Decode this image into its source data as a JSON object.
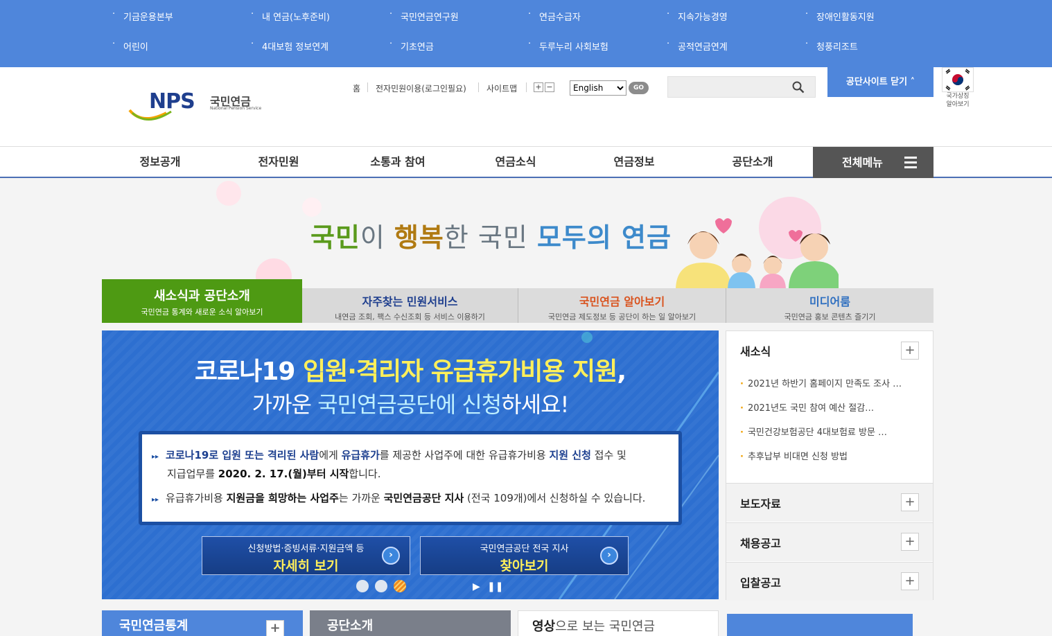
{
  "top_links": [
    [
      "기금운용본부",
      "내 연금(노후준비)",
      "국민연금연구원",
      "연금수급자",
      "지속가능경영",
      "장애인활동지원"
    ],
    [
      "어린이",
      "4대보험 정보연계",
      "기초연금",
      "두루누리 사회보험",
      "공적연금연계",
      "청풍리조트"
    ]
  ],
  "logo": {
    "mark": "NPS",
    "kr": "국민연금",
    "en": "National Pension Service"
  },
  "util": {
    "home": "홈",
    "ecivil": "전자민원이용(로그인필요)",
    "sitemap": "사이트맵",
    "font_plus": "+",
    "font_minus": "−",
    "lang": "English",
    "go": "GO"
  },
  "search": {
    "placeholder": ""
  },
  "close_site": "공단사이트 닫기 ˄",
  "flag_caption": [
    "국가상징",
    "알아보기"
  ],
  "gnb": [
    "정보공개",
    "전자민원",
    "소통과 참여",
    "연금소식",
    "연금정보",
    "공단소개"
  ],
  "all_menu": "전체메뉴",
  "slogan": {
    "s1": "국민",
    "s1b": "이 ",
    "s2": "행복",
    "s3": "한 국민 ",
    "s4": "모두의 연금"
  },
  "tabs": [
    {
      "title": "새소식과 공단소개",
      "desc": "국민연금 통계와 새로운 소식 알아보기",
      "color": "#ffffff"
    },
    {
      "title": "자주찾는 민원서비스",
      "desc": "내연금 조회, 팩스 수신조회 등 서비스 이용하기",
      "color": "#1f3f8e"
    },
    {
      "title": "국민연금 알아보기",
      "desc": "국민연금 제도정보 등 공단이 하는 일 알아보기",
      "color": "#d9531e"
    },
    {
      "title": "미디어룸",
      "desc": "국민연금 홍보 콘텐츠 즐기기",
      "color": "#2f6fc0"
    }
  ],
  "banner": {
    "h1a": "코로나19 ",
    "h1b": "입원·격리자 유급휴가비용 지원",
    "h1c": ",",
    "h2a": "가까운 ",
    "h2b": "국민연금공단에 신청",
    "h2c": "하세요!",
    "p1a": "코로나19로 입원 또는 격리된 사람",
    "p1b": "에게 ",
    "p1c": "유급휴가",
    "p1d": "를 제공한 사업주에 대한 유급휴가비용 ",
    "p1e": "지원 신청",
    "p1f": " 접수 및",
    "p1g": "지급업무를 ",
    "p1h": "2020. 2. 17.(월)부터 시작",
    "p1i": "합니다.",
    "p2a": "유급휴가비용 ",
    "p2b": "지원금을 희망하는 사업주",
    "p2c": "는 가까운 ",
    "p2d": "국민연금공단 지사",
    "p2e": " (전국 109개)에서 신청하실 수 있습니다.",
    "btn1_small": "신청방법·증빙서류·지원금액 등",
    "btn1_big": "자세히 보기",
    "btn2_small": "국민연금공단 전국 지사",
    "btn2_big": "찾아보기"
  },
  "news": {
    "title": "새소식",
    "items": [
      "2021년 하반기 홈페이지 만족도 조사 …",
      "2021년도 국민 참여 예산 절감…",
      "국민건강보험공단 4대보험료 방문 …",
      "추후납부 비대면 신청 방법"
    ],
    "sections": [
      "보도자료",
      "채용공고",
      "입찰공고"
    ]
  },
  "bottom": {
    "stats": "국민연금통계",
    "intro": "공단소개",
    "video_a": "영상",
    "video_b": "으로 보는 국민연금"
  }
}
